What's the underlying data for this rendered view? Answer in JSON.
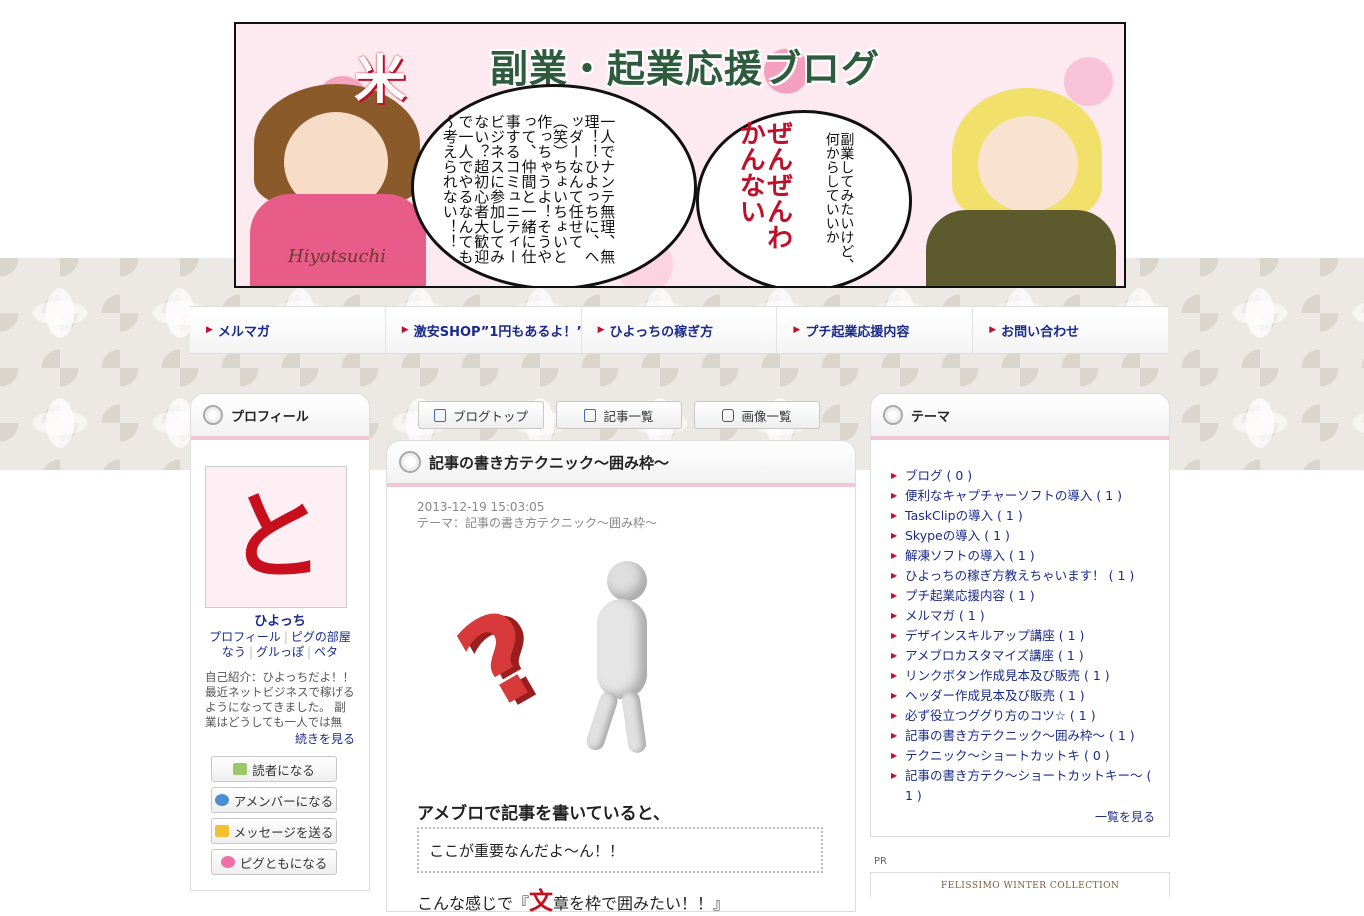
{
  "banner": {
    "title": "副業・起業応援ブログ",
    "bubble_left": "一人でナンテ無理、無理！！ひよっちに、ヘッダーなんて任せて（笑）ちょいちょいと作っちゃうよ！そうやって、仲間と一緒に仕事するコミュニティービジネスに参加してみない？超初心者大歓迎で一人でやるなんても～考えられない！！",
    "bubble_right_big": "ぜんぜんわかんない",
    "bubble_right_small": "副業してみたいけど、何からしていいか",
    "signature": "Hiyotsuchi",
    "deco": "米"
  },
  "nav": {
    "items": [
      {
        "label": "メルマガ"
      },
      {
        "label": "激安SHOP”1円もあるよ！”"
      },
      {
        "label": "ひよっちの稼ぎ方"
      },
      {
        "label": "プチ起業応援内容"
      },
      {
        "label": "お問い合わせ"
      }
    ]
  },
  "profile": {
    "heading": "プロフィール",
    "avatar_char": "と",
    "name": "ひよっち",
    "links": [
      "プロフィール",
      "ピグの部屋",
      "なう",
      "グルっぽ",
      "ペタ"
    ],
    "intro": "自己紹介：ひよっちだよ！！最近ネットビジネスで稼げるようになってきました。 副業はどうしても一人では無理…",
    "more": "続きを見る",
    "buttons": [
      "読者になる",
      "アメンバーになる",
      "メッセージを送る",
      "ピグともになる"
    ]
  },
  "toolbar": {
    "blog_top": "ブログトップ",
    "articles": "記事一覧",
    "images": "画像一覧"
  },
  "article": {
    "title": "記事の書き方テクニック～囲み枠～",
    "date": "2013-12-19 15:03:05",
    "theme": "テーマ：記事の書き方テクニック～囲み枠～",
    "heading": "アメブロで記事を書いていると、",
    "quote": "ここが重要なんだよ～ん！！",
    "line_prefix": "こんな感じで『",
    "line_big": "文",
    "line_rest": "章を枠で囲みたい！！』"
  },
  "theme": {
    "heading": "テーマ",
    "items": [
      "ブログ ( 0 )",
      "便利なキャプチャーソフトの導入 ( 1 )",
      "TaskClipの導入 ( 1 )",
      "Skypeの導入 ( 1 )",
      "解凍ソフトの導入 ( 1 )",
      "ひよっちの稼ぎ方教えちゃいます！ ( 1 )",
      "プチ起業応援内容 ( 1 )",
      "メルマガ ( 1 )",
      "デザインスキルアップ講座 ( 1 )",
      "アメブロカスタマイズ講座 ( 1 )",
      "リンクボタン作成見本及び販売 ( 1 )",
      "ヘッダー作成見本及び販売 ( 1 )",
      "必ず役立つググり方のコツ☆ ( 1 )",
      "記事の書き方テクニック～囲み枠～ ( 1 )",
      "テクニック～ショートカットキ ( 0 )",
      "記事の書き方テク～ショートカットキー～ ( 1 )"
    ],
    "list_all": "一覧を見る"
  },
  "pr": {
    "label": "PR",
    "banner_text": "FELISSIMO WINTER COLLECTION"
  },
  "colors": {
    "link": "#1a2a8a",
    "accent": "#c01030",
    "pink_rule": "#f2c7d4"
  }
}
